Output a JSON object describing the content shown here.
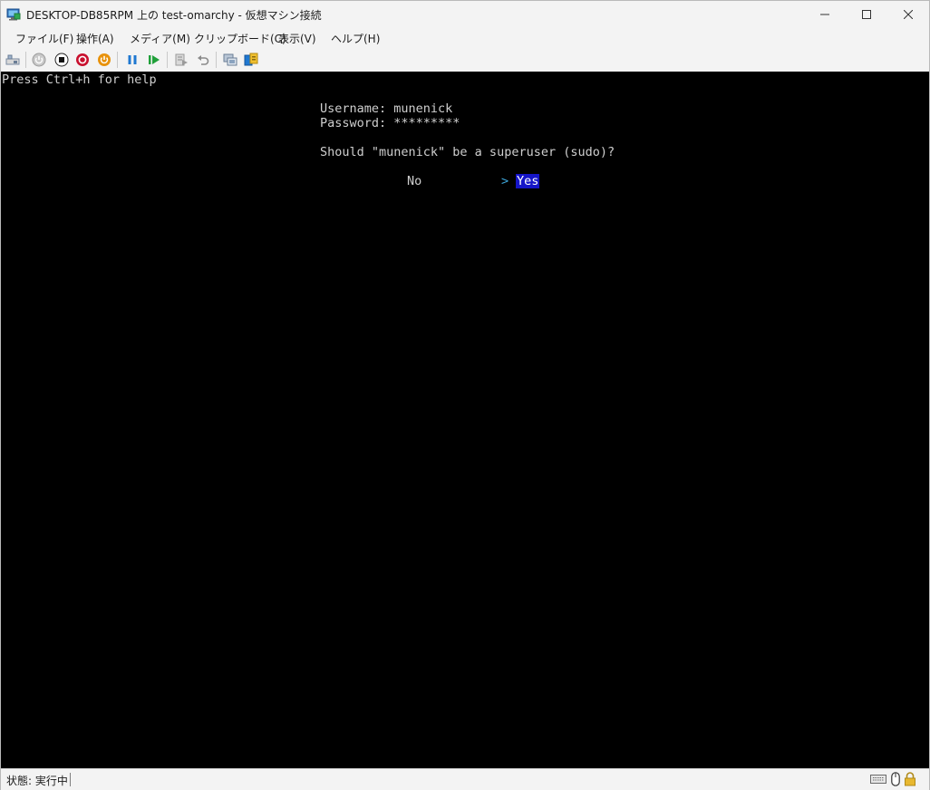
{
  "window": {
    "title": "DESKTOP-DB85RPM 上の test-omarchy  - 仮想マシン接続",
    "app_icon": "vm-connect-icon"
  },
  "menu": [
    {
      "label": "ファイル(F)"
    },
    {
      "label": "操作(A)"
    },
    {
      "label": "メディア(M)"
    },
    {
      "label": "クリップボード(C)"
    },
    {
      "label": "表示(V)"
    },
    {
      "label": "ヘルプ(H)"
    }
  ],
  "toolbar": {
    "icons": [
      "ctrl-alt-del-icon",
      "start-icon",
      "turn-off-icon",
      "shutdown-icon",
      "save-icon",
      "pause-icon",
      "reset-icon",
      "checkpoint-icon",
      "revert-icon",
      "enhanced-session-icon",
      "share-icon"
    ]
  },
  "console": {
    "help_line": "Press Ctrl+h for help",
    "username_line": "Username: munenick",
    "password_line": "Password: *********",
    "question": "Should \"munenick\" be a superuser (sudo)?",
    "option_no": "No",
    "arrow": ">",
    "option_yes": "Yes",
    "selected": "Yes"
  },
  "status": {
    "text": "状態: 実行中",
    "icons": [
      "keyboard-icon",
      "mouse-icon",
      "lock-icon"
    ]
  },
  "colors": {
    "screen_bg": "#000000",
    "terminal_text": "#cfcfcf",
    "selection_bg": "#1515c8",
    "arrow": "#3da5d9"
  }
}
